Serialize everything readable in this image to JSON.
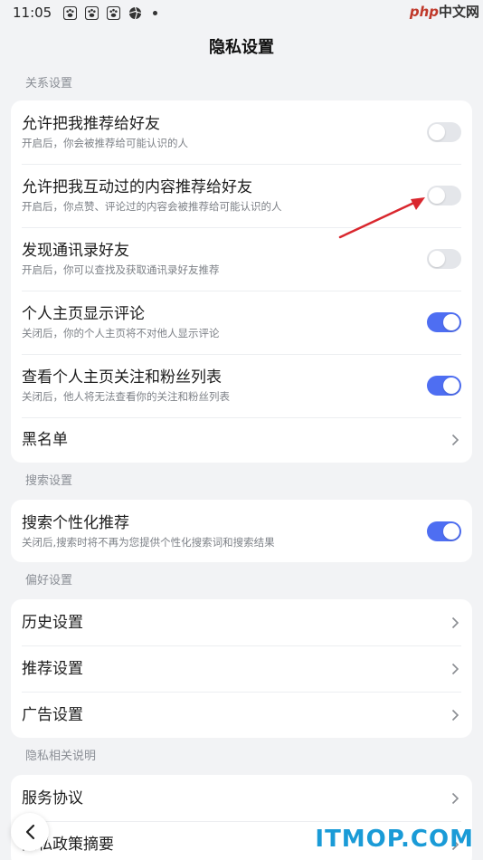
{
  "status_bar": {
    "time": "11:05"
  },
  "watermark_top": {
    "latin": "php",
    "cn": "中文网"
  },
  "header": {
    "title": "隐私设置"
  },
  "sections": {
    "relations": {
      "label": "关系设置",
      "items": [
        {
          "title": "允许把我推荐给好友",
          "desc": "开启后，你会被推荐给可能认识的人",
          "toggle": false
        },
        {
          "title": "允许把我互动过的内容推荐给好友",
          "desc": "开启后，你点赞、评论过的内容会被推荐给可能认识的人",
          "toggle": false
        },
        {
          "title": "发现通讯录好友",
          "desc": "开启后，你可以查找及获取通讯录好友推荐",
          "toggle": false
        },
        {
          "title": "个人主页显示评论",
          "desc": "关闭后，你的个人主页将不对他人显示评论",
          "toggle": true
        },
        {
          "title": "查看个人主页关注和粉丝列表",
          "desc": "关闭后，他人将无法查看你的关注和粉丝列表",
          "toggle": true
        },
        {
          "title": "黑名单"
        }
      ]
    },
    "search": {
      "label": "搜索设置",
      "items": [
        {
          "title": "搜索个性化推荐",
          "desc": "关闭后,搜索时将不再为您提供个性化搜索词和搜索结果",
          "toggle": true
        }
      ]
    },
    "preferences": {
      "label": "偏好设置",
      "items": [
        {
          "title": "历史设置"
        },
        {
          "title": "推荐设置"
        },
        {
          "title": "广告设置"
        }
      ]
    },
    "privacy_notes": {
      "label": "隐私相关说明",
      "items": [
        {
          "title": "服务协议"
        },
        {
          "title": "隐私政策摘要"
        }
      ]
    }
  },
  "colors": {
    "accent": "#4e6ef2",
    "toggle_off": "#e4e6ea",
    "annotation_arrow": "#d9272e"
  },
  "watermark_bottom": {
    "text": "ITMOP.COM"
  }
}
